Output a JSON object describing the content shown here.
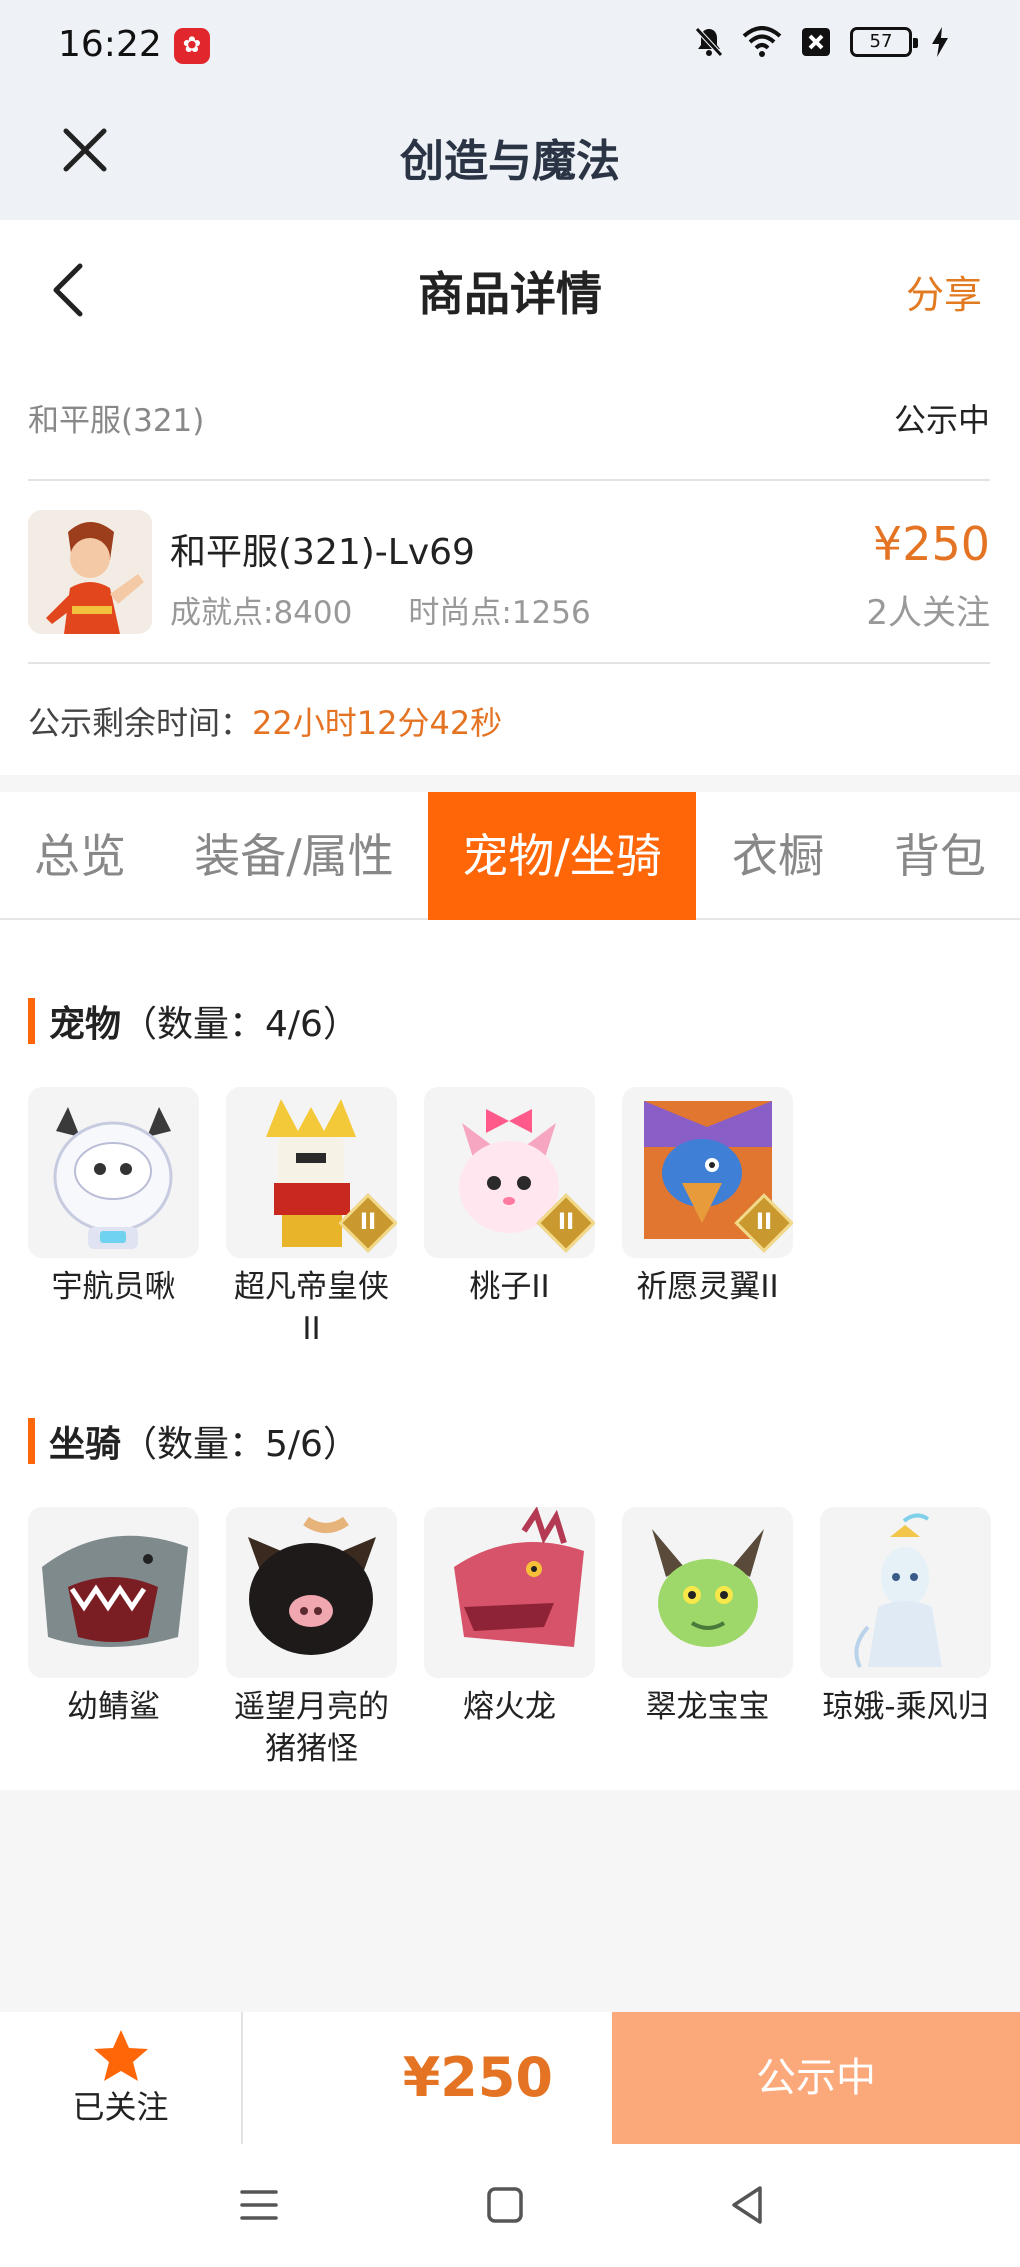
{
  "status_bar": {
    "time": "16:22",
    "app_icon": "pinduoduo-icon",
    "icons": [
      "mute-icon",
      "wifi-icon",
      "sim-x-icon",
      "battery-icon",
      "charging-icon"
    ],
    "battery": "57"
  },
  "app_bar": {
    "title": "创造与魔法",
    "close_icon": "close-icon"
  },
  "header": {
    "title": "商品详情",
    "back_icon": "back-icon",
    "share_label": "分享"
  },
  "listing": {
    "server": "和平服(321)",
    "status": "公示中",
    "role_name": "和平服(321)-Lv69",
    "achievement": "成就点:8400",
    "fashion": "时尚点:1256",
    "price": "¥250",
    "followers": "2人关注",
    "remaining_label": "公示剩余时间：",
    "remaining_value": "22小时12分42秒"
  },
  "tabs": [
    {
      "label": "总览",
      "active": false
    },
    {
      "label": "装备/属性",
      "active": false
    },
    {
      "label": "宠物/坐骑",
      "active": true
    },
    {
      "label": "衣橱",
      "active": false
    },
    {
      "label": "背包",
      "active": false
    }
  ],
  "pets": {
    "title": "宠物",
    "count": "（数量：4/6）",
    "items": [
      {
        "name": "宇航员啾",
        "badge": ""
      },
      {
        "name": "超凡帝皇侠II",
        "badge": "II"
      },
      {
        "name": "桃子II",
        "badge": "II"
      },
      {
        "name": "祈愿灵翼II",
        "badge": "II"
      }
    ]
  },
  "mounts": {
    "title": "坐骑",
    "count": "（数量：5/6）",
    "items": [
      {
        "name": "幼鲭鲨"
      },
      {
        "name": "遥望月亮的猪猪怪"
      },
      {
        "name": "熔火龙"
      },
      {
        "name": "翠龙宝宝"
      },
      {
        "name": "琼娥-乘风归"
      }
    ]
  },
  "bottom_bar": {
    "follow_label": "已关注",
    "star_icon": "star-icon",
    "price": "¥250",
    "status_button": "公示中"
  },
  "colors": {
    "accent": "#ff6607",
    "price": "#e47423",
    "status_button": "#fba97a"
  }
}
